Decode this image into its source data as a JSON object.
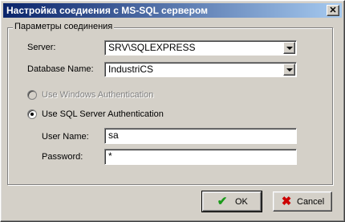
{
  "window": {
    "title": "Настройка соедиения с MS-SQL сервером",
    "close_label": "✕"
  },
  "group": {
    "legend": "Параметры соединения"
  },
  "server": {
    "label": "Server:",
    "value": "SRV\\SQLEXPRESS"
  },
  "database": {
    "label": "Database Name:",
    "value": "IndustriCS"
  },
  "auth": {
    "windows_label": "Use Windows Authentication",
    "windows_enabled": false,
    "sql_label": "Use SQL Server Authentication",
    "selected": "sql"
  },
  "user": {
    "label": "User Name:",
    "value": "sa"
  },
  "password": {
    "label": "Password:",
    "value": "*"
  },
  "buttons": {
    "ok": {
      "label": "OK",
      "icon": "checkmark-icon"
    },
    "cancel": {
      "label": "Cancel",
      "icon": "x-icon"
    }
  },
  "colors": {
    "ok_icon": "#1a9a1a",
    "cancel_icon": "#cc0000",
    "titlebar_start": "#0a246a",
    "titlebar_end": "#a6caf0"
  }
}
